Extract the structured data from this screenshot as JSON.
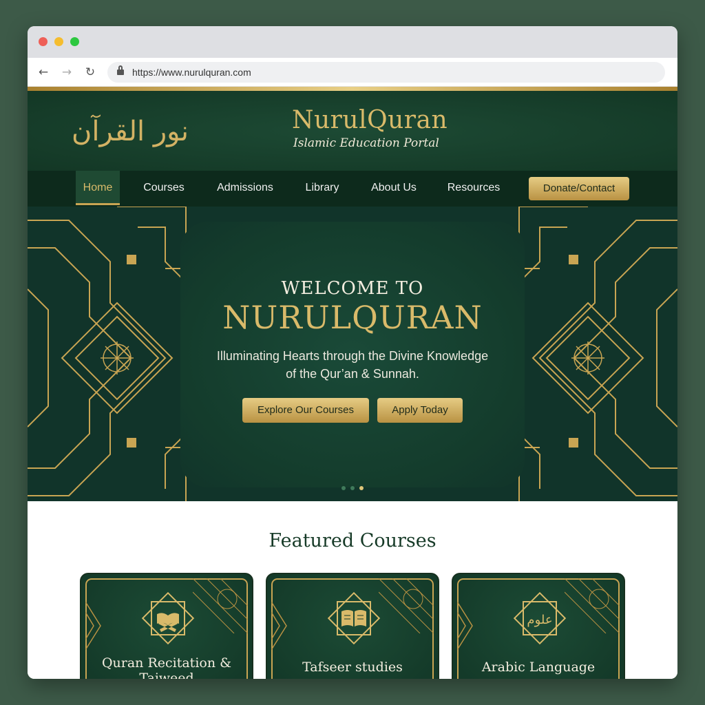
{
  "browser": {
    "url": "https://www.nurulquran.com",
    "back_icon": "←",
    "forward_icon": "→",
    "reload_icon": "↻"
  },
  "header": {
    "arabic_logo": "نور القرآن",
    "title": "NurulQuran",
    "tagline": "Islamic Education Portal"
  },
  "nav": {
    "items": [
      {
        "label": "Home",
        "active": true
      },
      {
        "label": "Courses"
      },
      {
        "label": "Admissions"
      },
      {
        "label": "Library"
      },
      {
        "label": "About Us"
      },
      {
        "label": "Resources"
      }
    ],
    "donate_label": "Donate/Contact"
  },
  "hero": {
    "pre_title": "WELCOME TO",
    "title": "NURULQURAN",
    "subtitle": "Illuminating Hearts through the Divine Knowledge of the Qur’an & Sunnah.",
    "explore_label": "Explore Our Courses",
    "apply_label": "Apply Today",
    "slide_count": 3,
    "active_slide": 3
  },
  "featured": {
    "title": "Featured Courses",
    "courses": [
      {
        "label": "Quran Recitation & Tajweed",
        "icon": "quran-stand-icon"
      },
      {
        "label": "Tafseer studies",
        "icon": "open-book-icon"
      },
      {
        "label": "Arabic Language",
        "icon": "arabic-calligraphy-icon",
        "calligraphy": "علوم"
      }
    ]
  },
  "colors": {
    "green_dark": "#0d2a1c",
    "green": "#173f2c",
    "gold": "#d9ba6a",
    "gold_dark": "#b99243"
  }
}
